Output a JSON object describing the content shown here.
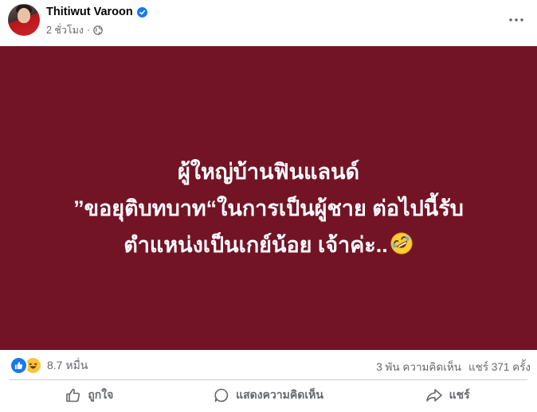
{
  "post": {
    "author": "Thitiwut Varoon",
    "time": "2 ชั่วโมง",
    "separator": "·",
    "verified_icon": "verified-badge-icon",
    "privacy_icon": "globe-icon"
  },
  "content": {
    "lines": [
      "ผู้ใหญ่บ้านฟินแลนด์",
      "”ขอยุติบทบาท“ในการเป็นผู้ชาย ต่อไปนี้รับ",
      "ตำแหน่งเป็นเกย์น้อย เจ้าค่ะ.."
    ],
    "emoji": "rolling-on-floor-laughing-emoji",
    "background_color": "#731426"
  },
  "stats": {
    "reactions": "8.7 หมื่น",
    "reaction_icons": [
      "like-icon",
      "haha-icon"
    ],
    "comments": "3 พัน ความคิดเห็น",
    "shares": "แชร์ 371 ครั้ง"
  },
  "actions": {
    "like": "ถูกใจ",
    "comment": "แสดงความคิดเห็น",
    "share": "แชร์"
  },
  "colors": {
    "brand_blue": "#1877f2",
    "secondary_text": "#65676b"
  }
}
